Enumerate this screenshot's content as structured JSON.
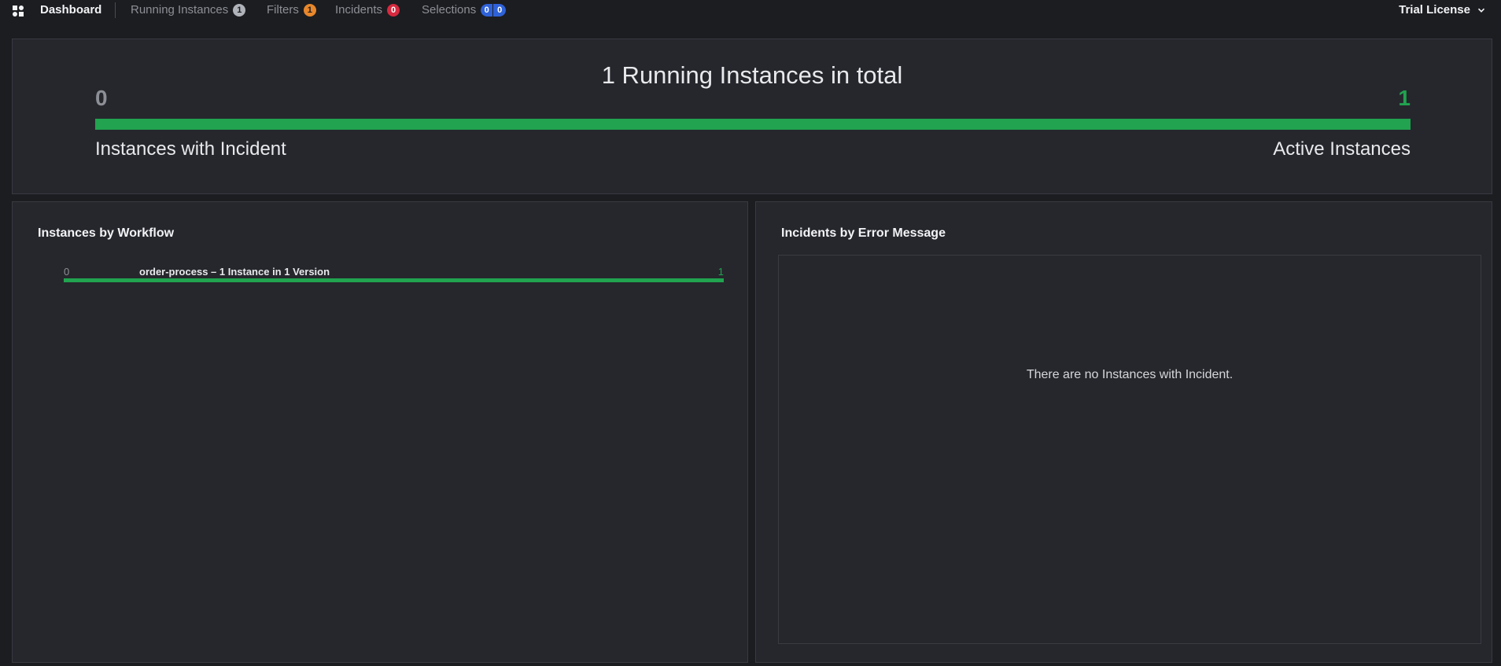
{
  "header": {
    "dashboard_label": "Dashboard",
    "running_label": "Running Instances",
    "running_count": "1",
    "filters_label": "Filters",
    "filters_count": "1",
    "incidents_label": "Incidents",
    "incidents_count": "0",
    "selections_label": "Selections",
    "selections_count_a": "0",
    "selections_count_b": "0",
    "license_label": "Trial License"
  },
  "metrics": {
    "title": "1 Running Instances in total",
    "incident_count": "0",
    "active_count": "1",
    "incident_label": "Instances with Incident",
    "active_label": "Active Instances",
    "active_fraction": 1.0
  },
  "workflows": {
    "title": "Instances by Workflow",
    "items": [
      {
        "incident_count": "0",
        "name": "order-process – 1 Instance in 1 Version",
        "active_count": "1",
        "active_fraction": 1.0
      }
    ]
  },
  "incidents": {
    "title": "Incidents by Error Message",
    "empty_message": "There are no Instances with Incident."
  },
  "colors": {
    "active": "#21a34f",
    "incident": "#d62a3f",
    "filters": "#e8872b",
    "selection": "#2f62d8"
  },
  "icons": [
    "logo-icon",
    "chevron-down-icon"
  ]
}
